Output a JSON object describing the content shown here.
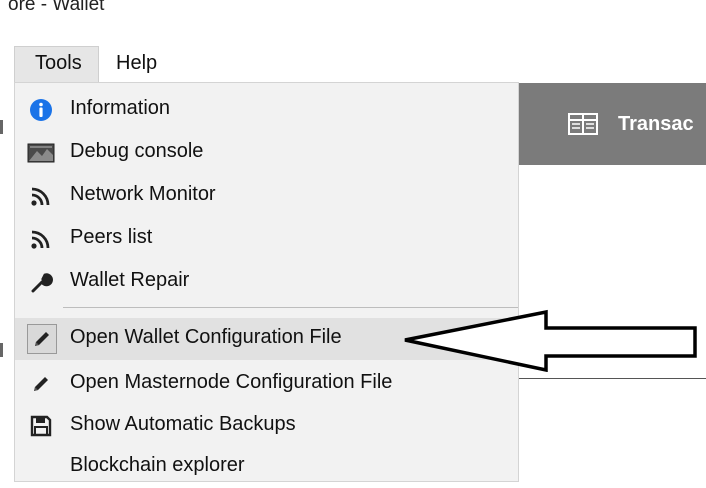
{
  "window": {
    "title": "ore - Wallet"
  },
  "menubar": {
    "tools_label": "Tools",
    "help_label": "Help"
  },
  "background": {
    "panel_label": "Transac"
  },
  "menu": {
    "items": [
      {
        "label": "Information",
        "icon": "info-icon"
      },
      {
        "label": "Debug console",
        "icon": "console-icon"
      },
      {
        "label": "Network Monitor",
        "icon": "network-icon"
      },
      {
        "label": "Peers list",
        "icon": "peers-icon"
      },
      {
        "label": "Wallet Repair",
        "icon": "wrench-icon"
      },
      {
        "label": "Open Wallet Configuration File",
        "icon": "pencil-icon",
        "highlighted": true
      },
      {
        "label": "Open Masternode Configuration File",
        "icon": "pencil-icon"
      },
      {
        "label": "Show Automatic Backups",
        "icon": "floppy-disk-icon"
      },
      {
        "label": "Blockchain explorer",
        "icon": ""
      }
    ]
  },
  "colors": {
    "menu_background": "#f2f2f2",
    "highlight": "#e1e1e1",
    "info_blue": "#1a73e8",
    "panel_gray": "#7b7b7b"
  }
}
